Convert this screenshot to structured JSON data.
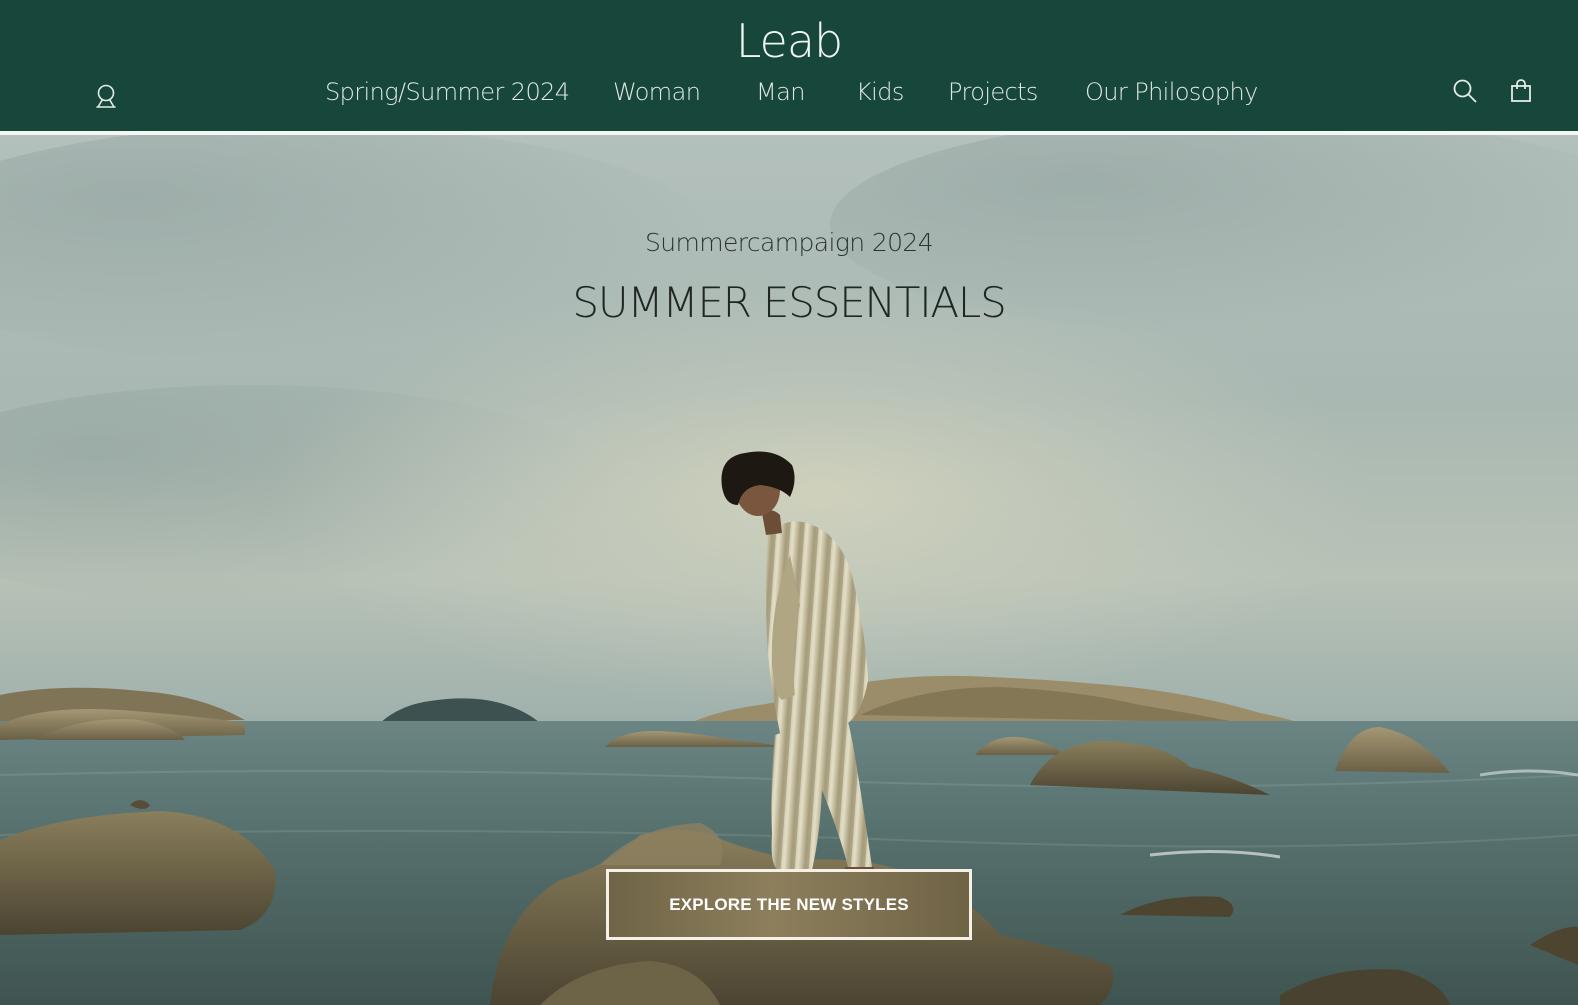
{
  "brand": {
    "logo_text": "Leab",
    "header_color": "#17463b"
  },
  "nav": {
    "items": [
      {
        "label": "Spring/Summer 2024"
      },
      {
        "label": "Woman"
      },
      {
        "label": "Man"
      },
      {
        "label": "Kids"
      },
      {
        "label": "Projects"
      },
      {
        "label": "Our Philosophy"
      }
    ]
  },
  "icons": {
    "account": "user-icon",
    "search": "search-icon",
    "cart": "shopping-bag-icon"
  },
  "hero": {
    "subtitle": "Summercampaign 2024",
    "title": "SUMMER ESSENTIALS",
    "cta_label": "EXPLORE THE NEW STYLES"
  }
}
